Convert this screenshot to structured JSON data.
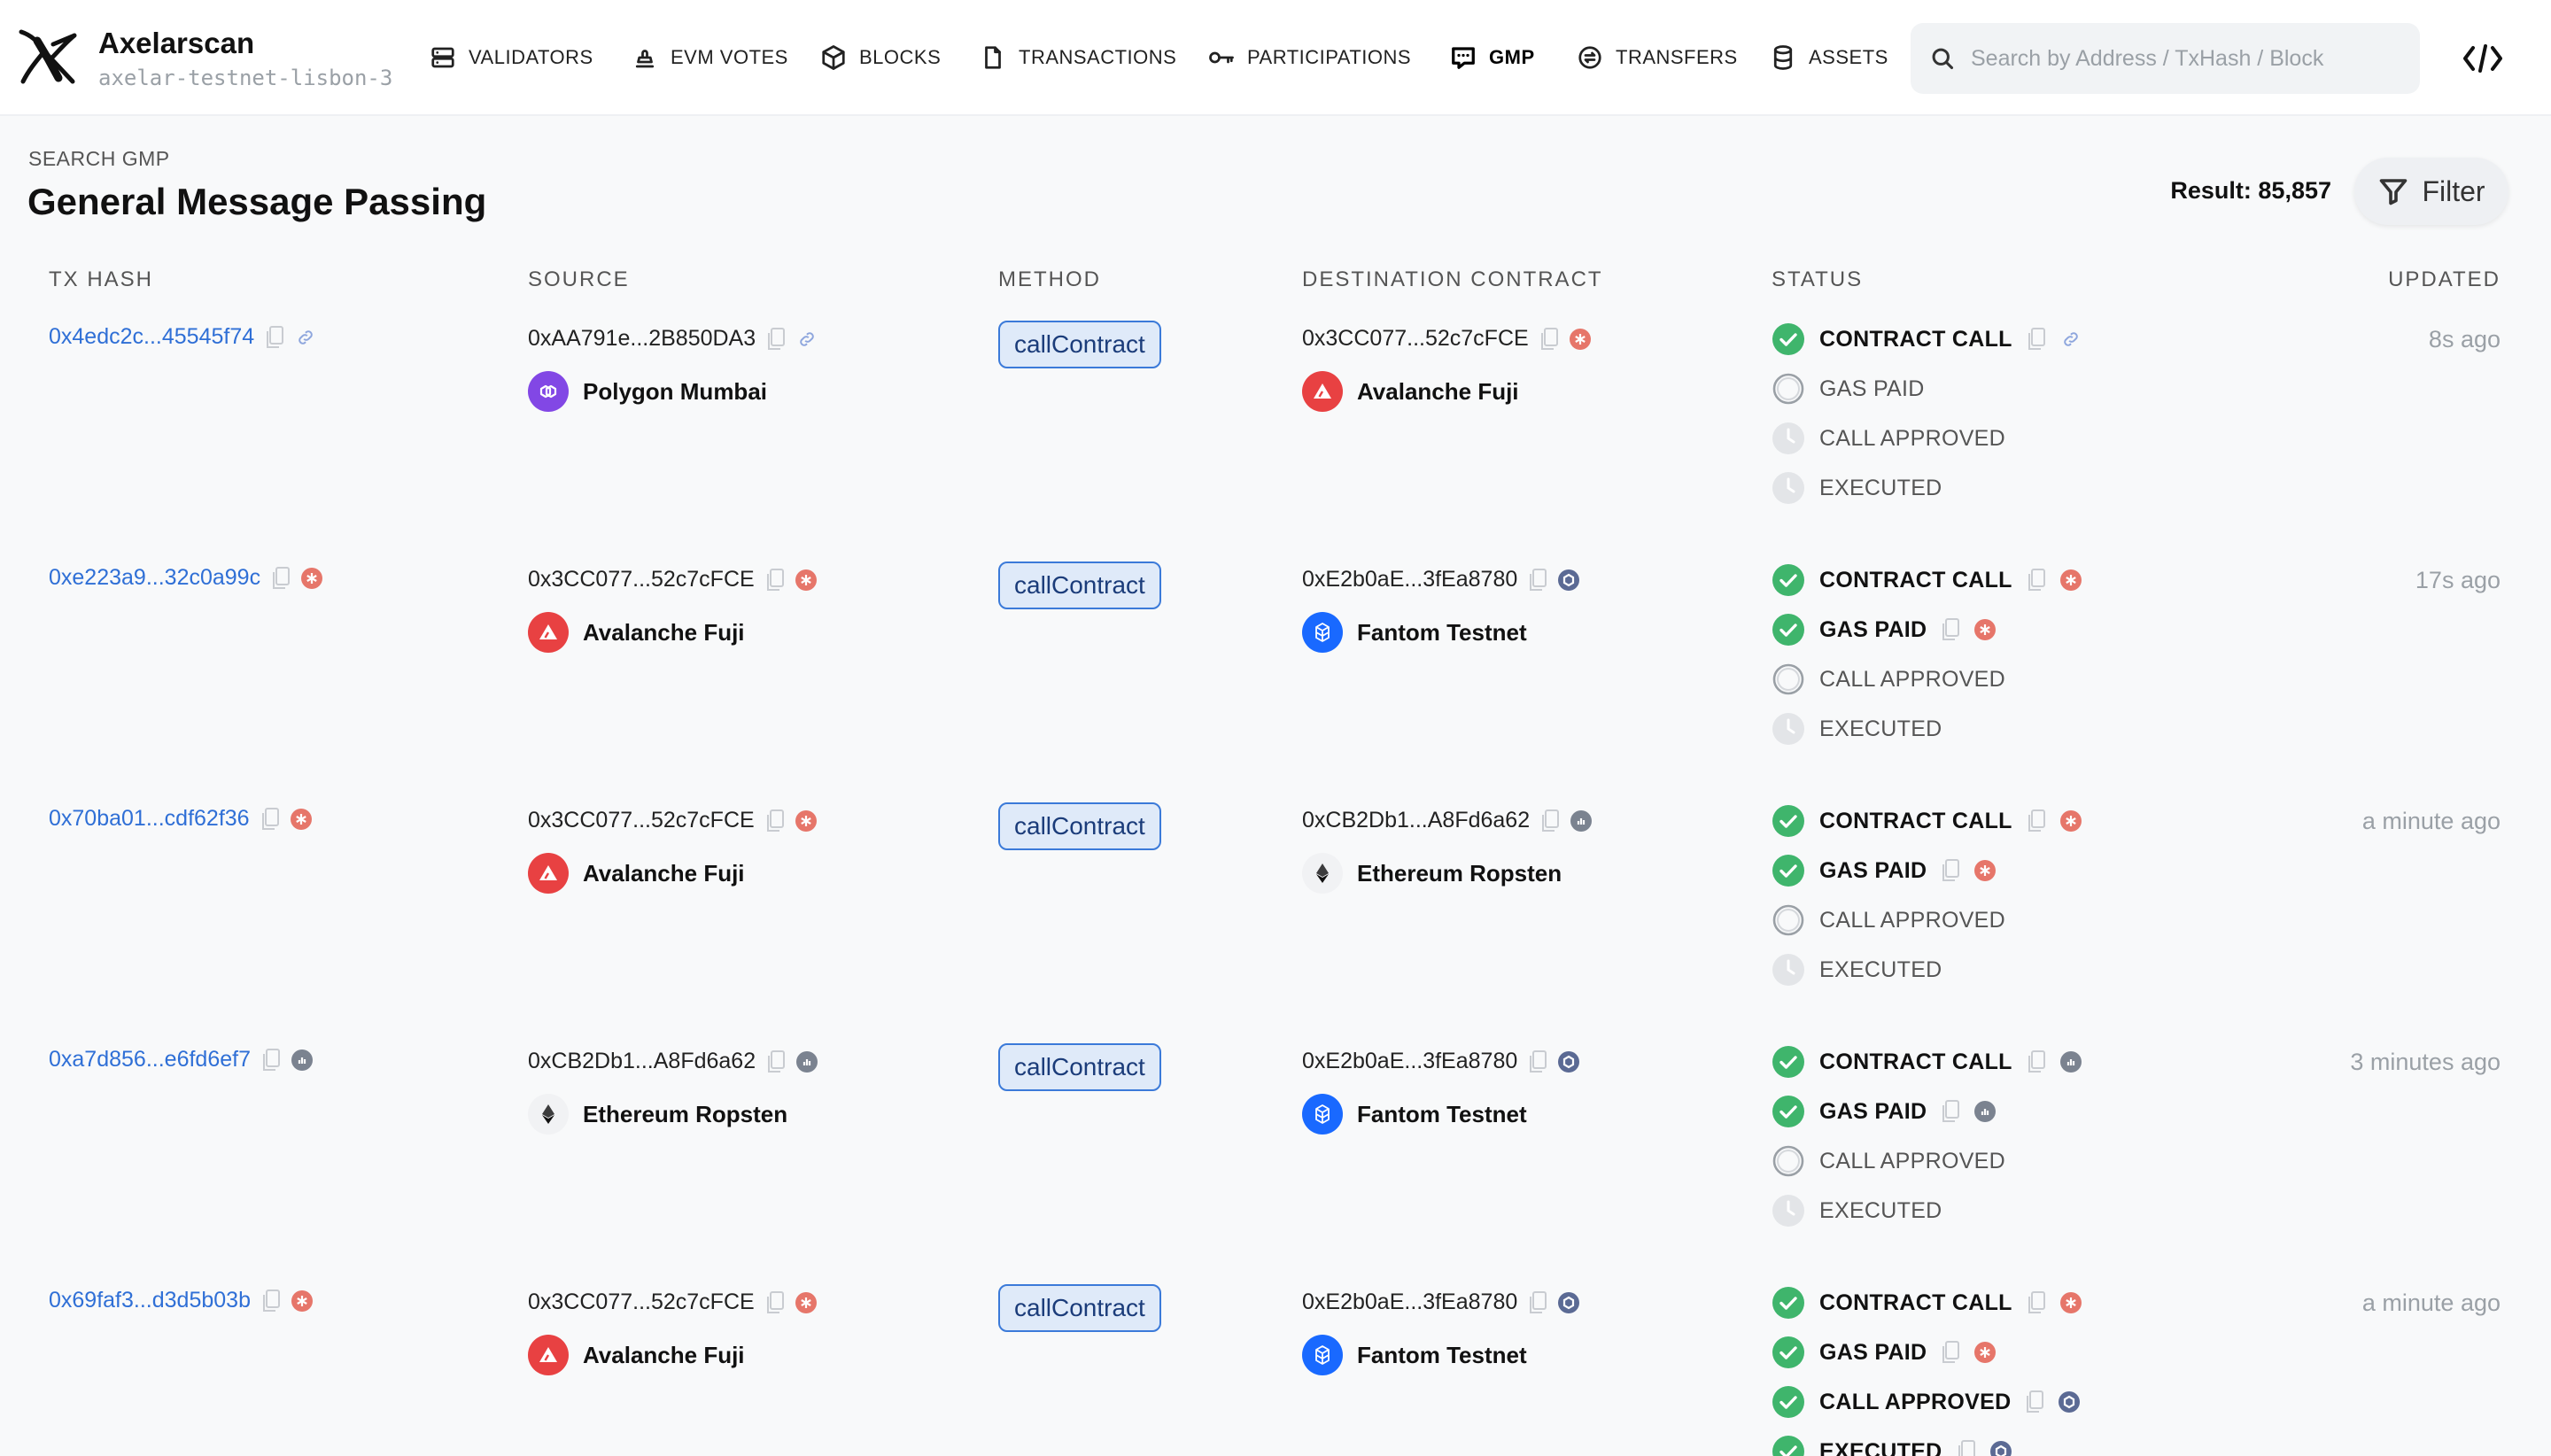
{
  "nav": {
    "brand_title": "Axelarscan",
    "brand_subtitle": "axelar-testnet-lisbon-3",
    "items": [
      {
        "label": "VALIDATORS",
        "icon": "server-icon"
      },
      {
        "label": "EVM VOTES",
        "icon": "stamp-icon"
      },
      {
        "label": "BLOCKS",
        "icon": "cube-icon"
      },
      {
        "label": "TRANSACTIONS",
        "icon": "file-icon"
      },
      {
        "label": "PARTICIPATIONS",
        "icon": "key-icon"
      },
      {
        "label": "GMP",
        "icon": "message-icon",
        "active": true
      },
      {
        "label": "TRANSFERS",
        "icon": "transfer-icon"
      },
      {
        "label": "ASSETS",
        "icon": "database-icon"
      }
    ],
    "search_placeholder": "Search by Address / TxHash / Block"
  },
  "header": {
    "eyebrow": "SEARCH GMP",
    "title": "General Message Passing",
    "result": "Result: 85,857",
    "filter_label": "Filter"
  },
  "columns": [
    "TX HASH",
    "SOURCE",
    "METHOD",
    "DESTINATION CONTRACT",
    "STATUS",
    "UPDATED"
  ],
  "colors": {
    "link": "#2f6fd6",
    "success": "#3fb56c",
    "avalanche": "#e84142",
    "polygon": "#8247e5",
    "fantom": "#1969ff",
    "ethereum": "#3c3c3d"
  },
  "rows": [
    {
      "tx_hash": "0x4edc2c...45545f74",
      "tx_explorer": "link-icon",
      "source_address": "0xAA791e...2B850DA3",
      "source_explorer": "link-icon",
      "source_chain": "Polygon Mumbai",
      "source_chain_icon": "polygon-icon",
      "method": "callContract",
      "dest_address": "0x3CC077...52c7cFCE",
      "dest_explorer": "snowtrace-icon",
      "dest_chain": "Avalanche Fuji",
      "dest_chain_icon": "avalanche-icon",
      "statuses": [
        {
          "label": "CONTRACT CALL",
          "state": "done",
          "explorer": "link-icon"
        },
        {
          "label": "GAS PAID",
          "state": "pending"
        },
        {
          "label": "CALL APPROVED",
          "state": "wait"
        },
        {
          "label": "EXECUTED",
          "state": "wait"
        }
      ],
      "updated": "8s ago"
    },
    {
      "tx_hash": "0xe223a9...32c0a99c",
      "tx_explorer": "snowtrace-icon",
      "source_address": "0x3CC077...52c7cFCE",
      "source_explorer": "snowtrace-icon",
      "source_chain": "Avalanche Fuji",
      "source_chain_icon": "avalanche-icon",
      "method": "callContract",
      "dest_address": "0xE2b0aE...3fEa8780",
      "dest_explorer": "ftmscan-icon",
      "dest_chain": "Fantom Testnet",
      "dest_chain_icon": "fantom-icon",
      "statuses": [
        {
          "label": "CONTRACT CALL",
          "state": "done",
          "explorer": "snowtrace-icon"
        },
        {
          "label": "GAS PAID",
          "state": "done",
          "explorer": "snowtrace-icon"
        },
        {
          "label": "CALL APPROVED",
          "state": "pending"
        },
        {
          "label": "EXECUTED",
          "state": "wait"
        }
      ],
      "updated": "17s ago"
    },
    {
      "tx_hash": "0x70ba01...cdf62f36",
      "tx_explorer": "snowtrace-icon",
      "source_address": "0x3CC077...52c7cFCE",
      "source_explorer": "snowtrace-icon",
      "source_chain": "Avalanche Fuji",
      "source_chain_icon": "avalanche-icon",
      "method": "callContract",
      "dest_address": "0xCB2Db1...A8Fd6a62",
      "dest_explorer": "etherscan-icon",
      "dest_chain": "Ethereum Ropsten",
      "dest_chain_icon": "ethereum-icon",
      "statuses": [
        {
          "label": "CONTRACT CALL",
          "state": "done",
          "explorer": "snowtrace-icon"
        },
        {
          "label": "GAS PAID",
          "state": "done",
          "explorer": "snowtrace-icon"
        },
        {
          "label": "CALL APPROVED",
          "state": "pending"
        },
        {
          "label": "EXECUTED",
          "state": "wait"
        }
      ],
      "updated": "a minute ago"
    },
    {
      "tx_hash": "0xa7d856...e6fd6ef7",
      "tx_explorer": "etherscan-icon",
      "source_address": "0xCB2Db1...A8Fd6a62",
      "source_explorer": "etherscan-icon",
      "source_chain": "Ethereum Ropsten",
      "source_chain_icon": "ethereum-icon",
      "method": "callContract",
      "dest_address": "0xE2b0aE...3fEa8780",
      "dest_explorer": "ftmscan-icon",
      "dest_chain": "Fantom Testnet",
      "dest_chain_icon": "fantom-icon",
      "statuses": [
        {
          "label": "CONTRACT CALL",
          "state": "done",
          "explorer": "etherscan-icon"
        },
        {
          "label": "GAS PAID",
          "state": "done",
          "explorer": "etherscan-icon"
        },
        {
          "label": "CALL APPROVED",
          "state": "pending"
        },
        {
          "label": "EXECUTED",
          "state": "wait"
        }
      ],
      "updated": "3 minutes ago"
    },
    {
      "tx_hash": "0x69faf3...d3d5b03b",
      "tx_explorer": "snowtrace-icon",
      "source_address": "0x3CC077...52c7cFCE",
      "source_explorer": "snowtrace-icon",
      "source_chain": "Avalanche Fuji",
      "source_chain_icon": "avalanche-icon",
      "method": "callContract",
      "dest_address": "0xE2b0aE...3fEa8780",
      "dest_explorer": "ftmscan-icon",
      "dest_chain": "Fantom Testnet",
      "dest_chain_icon": "fantom-icon",
      "statuses": [
        {
          "label": "CONTRACT CALL",
          "state": "done",
          "explorer": "snowtrace-icon"
        },
        {
          "label": "GAS PAID",
          "state": "done",
          "explorer": "snowtrace-icon"
        },
        {
          "label": "CALL APPROVED",
          "state": "done",
          "explorer": "ftmscan-icon"
        },
        {
          "label": "EXECUTED",
          "state": "done",
          "explorer": "ftmscan-icon"
        }
      ],
      "updated": "a minute ago"
    }
  ]
}
